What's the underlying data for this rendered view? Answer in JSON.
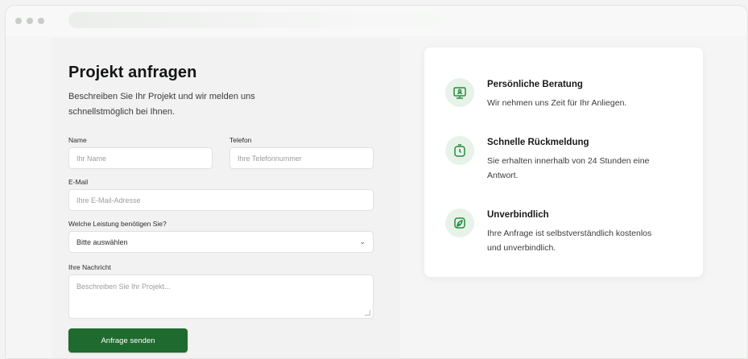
{
  "form": {
    "title": "Projekt anfragen",
    "description": "Beschreiben Sie Ihr Projekt und wir melden uns schnellstmöglich bei Ihnen.",
    "name": {
      "label": "Name",
      "placeholder": "Ihr Name"
    },
    "phone": {
      "label": "Telefon",
      "placeholder": "Ihre Telefonnummer"
    },
    "email": {
      "label": "E-Mail",
      "placeholder": "Ihre E-Mail-Adresse"
    },
    "service": {
      "label": "Welche Leistung benötigen Sie?",
      "selected": "Bitte auswählen"
    },
    "message": {
      "label": "Ihre Nachricht",
      "placeholder": "Beschreiben Sie Ihr Projekt..."
    },
    "submit_label": "Anfrage senden"
  },
  "features": [
    {
      "icon": "consultation-icon",
      "title": "Persönliche Beratung",
      "text": "Wir nehmen uns Zeit für Ihr Anliegen."
    },
    {
      "icon": "stopwatch-icon",
      "title": "Schnelle Rückmeldung",
      "text": "Sie erhalten innerhalb von 24 Stunden eine Antwort."
    },
    {
      "icon": "leaf-icon",
      "title": "Unverbindlich",
      "text": "Ihre Anfrage ist selbstverständlich kostenlos und unverbindlich."
    }
  ],
  "colors": {
    "accent": "#1f6a2e",
    "icon_bg": "#e7f3e9",
    "icon_stroke": "#2a8a3e"
  }
}
